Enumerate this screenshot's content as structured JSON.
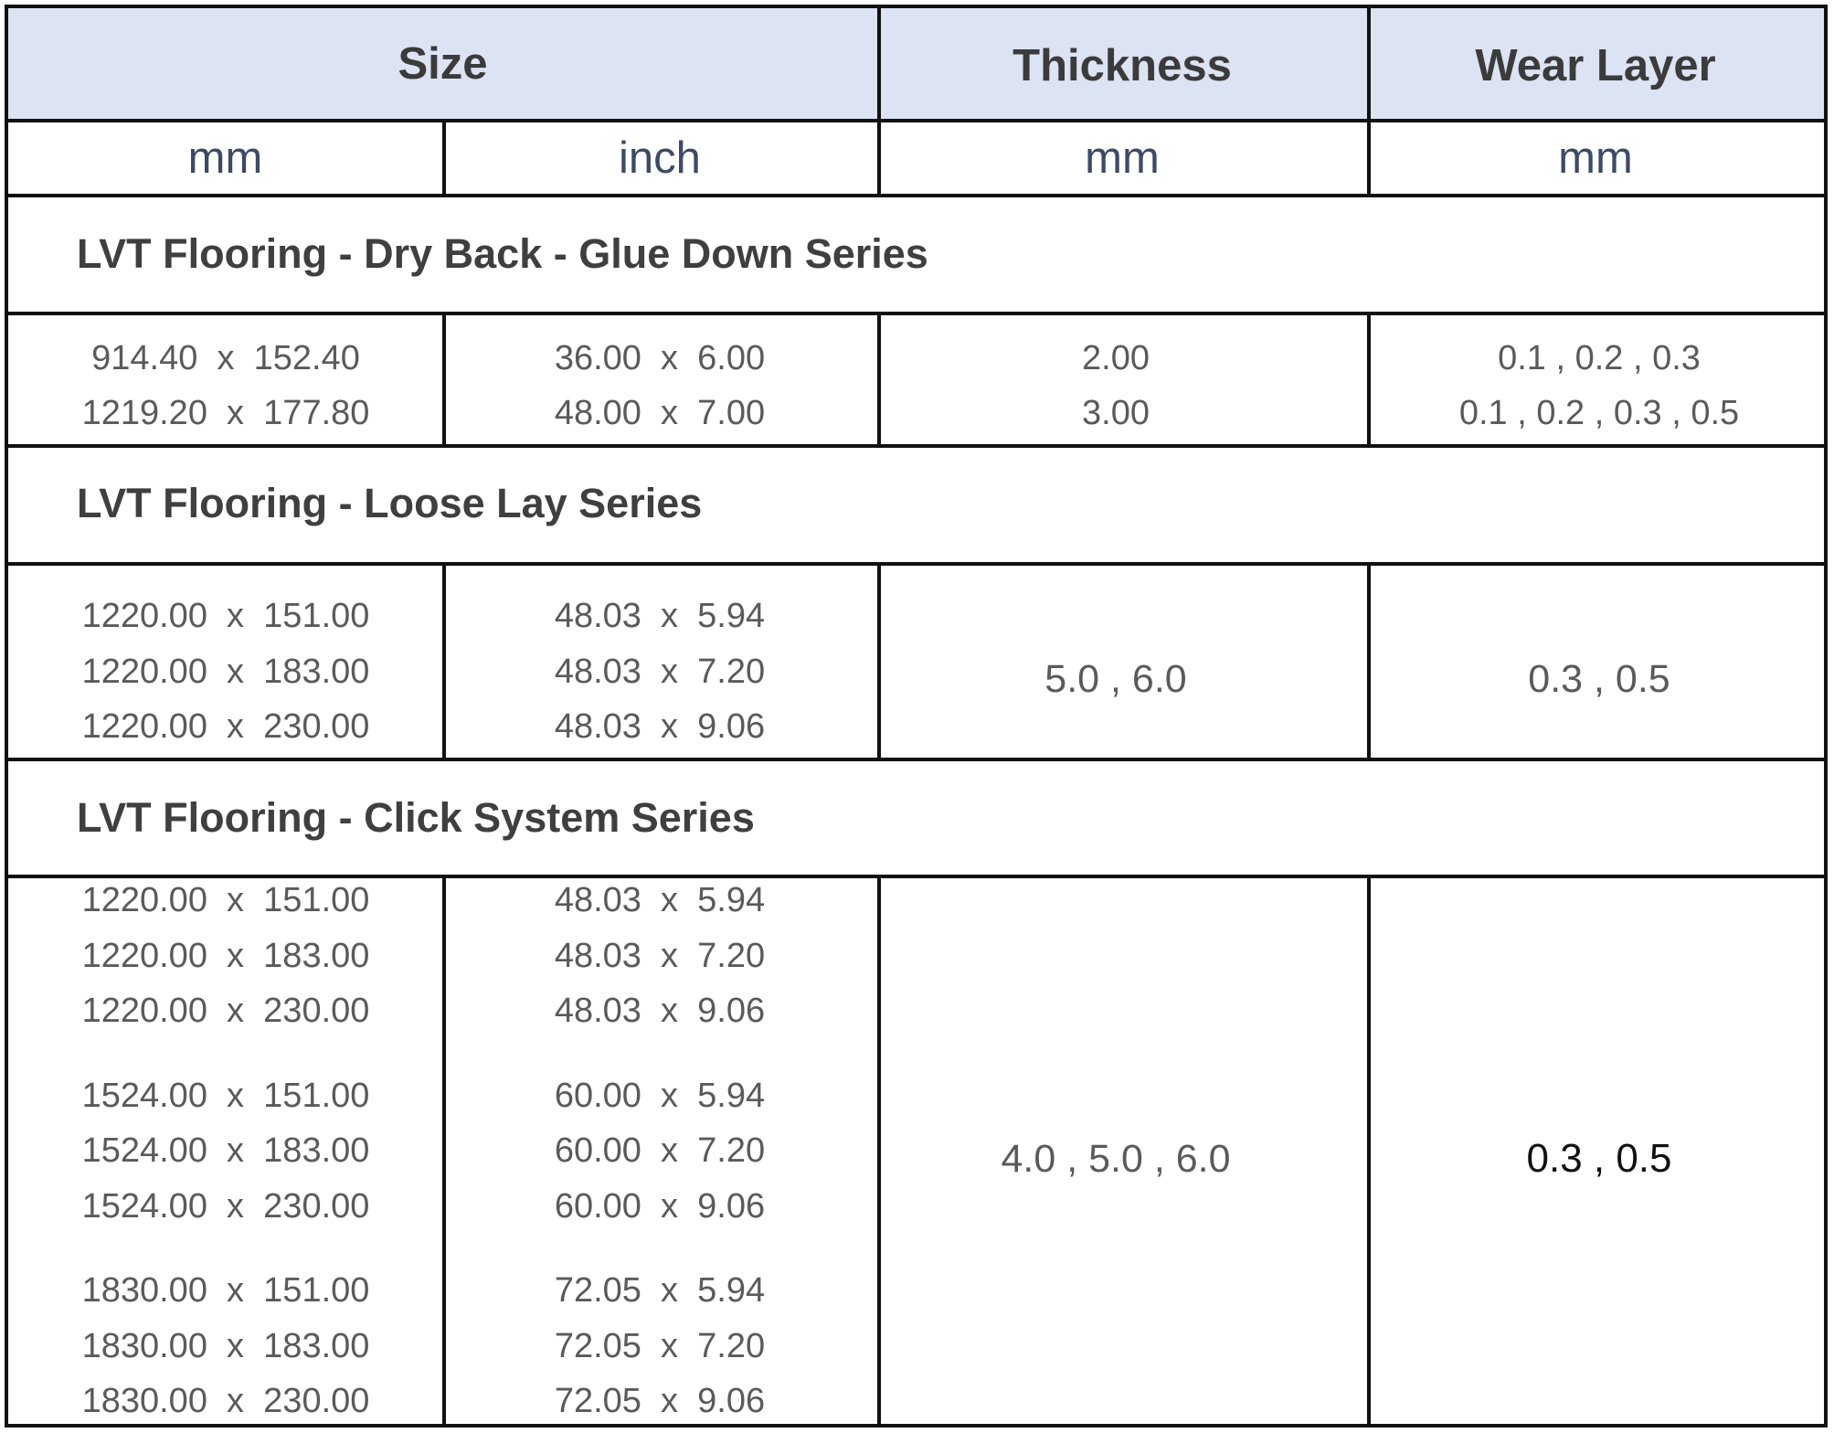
{
  "header": {
    "size": "Size",
    "thickness": "Thickness",
    "wear_layer": "Wear Layer",
    "unit_size_mm": "mm",
    "unit_size_inch": "inch",
    "unit_thickness": "mm",
    "unit_wear": "mm"
  },
  "sections": [
    {
      "title": "LVT Flooring - Dry Back - Glue Down Series",
      "mm": [
        "914.40  x  152.40",
        "1219.20  x  177.80"
      ],
      "inch": [
        "36.00  x  6.00",
        "48.00  x  7.00"
      ],
      "thickness": [
        "2.00",
        "3.00"
      ],
      "wear": [
        "0.1 , 0.2 , 0.3",
        "0.1 , 0.2 , 0.3 , 0.5"
      ]
    },
    {
      "title": "LVT Flooring - Loose Lay Series",
      "mm": [
        "1220.00  x  151.00",
        "1220.00  x  183.00",
        "1220.00  x  230.00"
      ],
      "inch": [
        "48.03  x  5.94",
        "48.03  x  7.20",
        "48.03  x  9.06"
      ],
      "thickness": "5.0 , 6.0",
      "wear": "0.3 , 0.5"
    },
    {
      "title": "LVT Flooring - Click System Series",
      "mm": [
        "1220.00  x  151.00",
        "1220.00  x  183.00",
        "1220.00  x  230.00",
        "1524.00  x  151.00",
        "1524.00  x  183.00",
        "1524.00  x  230.00",
        "1830.00  x  151.00",
        "1830.00  x  183.00",
        "1830.00  x  230.00"
      ],
      "inch": [
        "48.03  x  5.94",
        "48.03  x  7.20",
        "48.03  x  9.06",
        "60.00  x  5.94",
        "60.00  x  7.20",
        "60.00  x  9.06",
        "72.05  x  5.94",
        "72.05  x  7.20",
        "72.05  x  9.06"
      ],
      "thickness": "4.0 , 5.0 , 6.0",
      "wear": "0.3 , 0.5"
    }
  ]
}
